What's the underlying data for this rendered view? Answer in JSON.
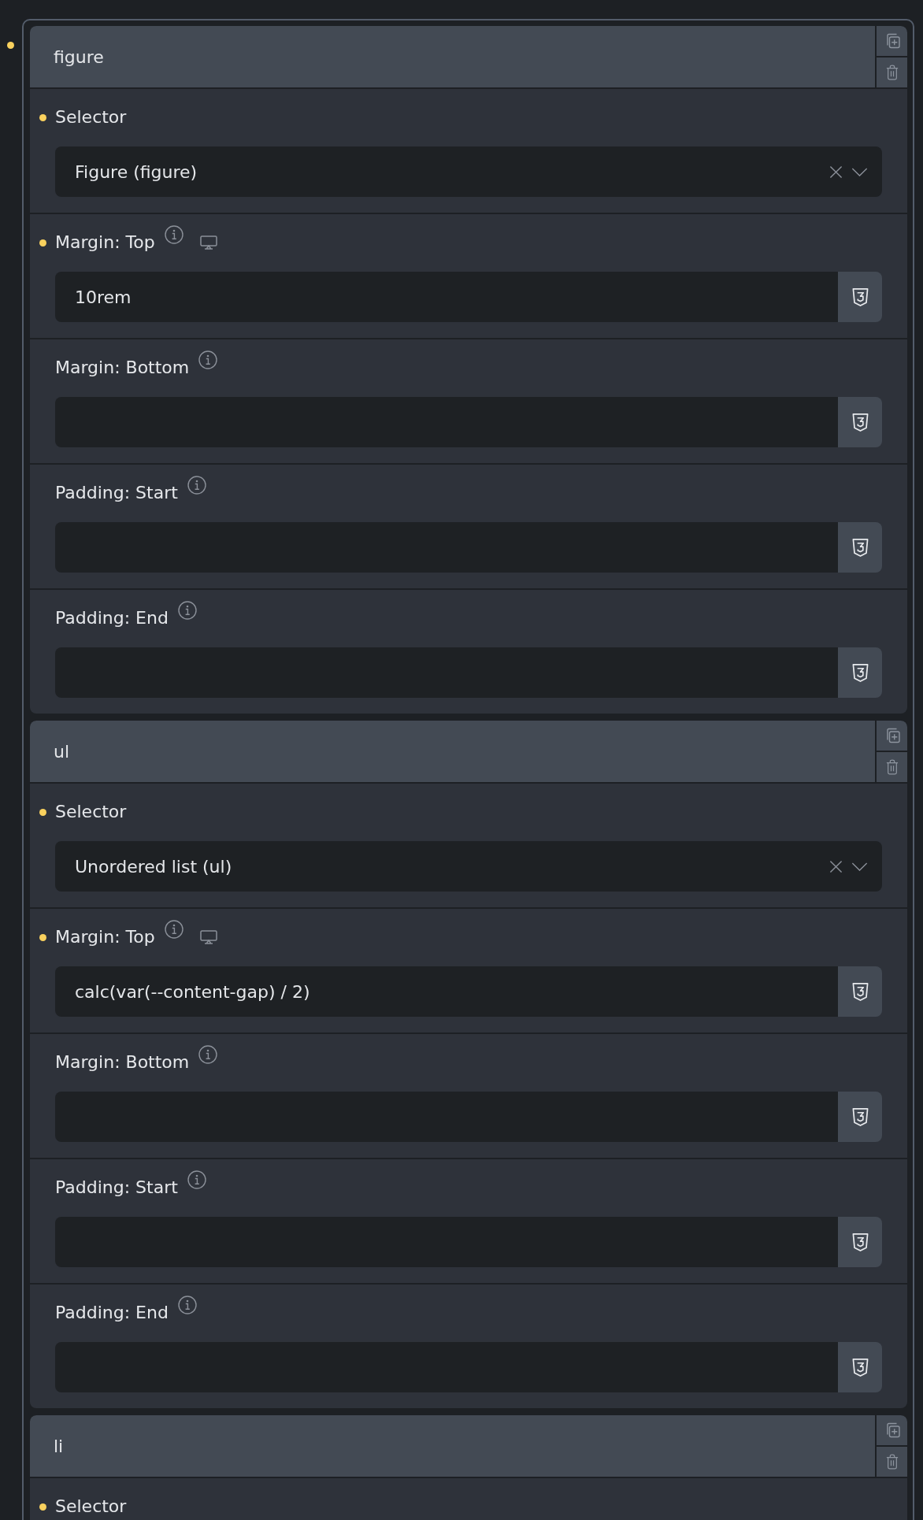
{
  "repeater": {
    "modified": true,
    "items": [
      {
        "title": "figure",
        "fields": [
          {
            "kind": "select",
            "label": "Selector",
            "modified": true,
            "info": false,
            "responsive": false,
            "value": "Figure (figure)"
          },
          {
            "kind": "text",
            "label": "Margin: Top",
            "modified": true,
            "info": true,
            "responsive": true,
            "value": "10rem"
          },
          {
            "kind": "text",
            "label": "Margin: Bottom",
            "modified": false,
            "info": true,
            "responsive": false
          },
          {
            "kind": "text",
            "label": "Padding: Start",
            "modified": false,
            "info": true,
            "responsive": false
          },
          {
            "kind": "text",
            "label": "Padding: End",
            "modified": false,
            "info": true,
            "responsive": false
          }
        ]
      },
      {
        "title": "ul",
        "fields": [
          {
            "kind": "select",
            "label": "Selector",
            "modified": true,
            "info": false,
            "responsive": false,
            "value": "Unordered list (ul)"
          },
          {
            "kind": "text",
            "label": "Margin: Top",
            "modified": true,
            "info": true,
            "responsive": true,
            "value": "calc(var(--content-gap) / 2)"
          },
          {
            "kind": "text",
            "label": "Margin: Bottom",
            "modified": false,
            "info": true,
            "responsive": false
          },
          {
            "kind": "text",
            "label": "Padding: Start",
            "modified": false,
            "info": true,
            "responsive": false
          },
          {
            "kind": "text",
            "label": "Padding: End",
            "modified": false,
            "info": true,
            "responsive": false
          }
        ]
      },
      {
        "title": "li",
        "fields": [
          {
            "kind": "select",
            "label": "Selector",
            "modified": true,
            "info": false,
            "responsive": false
          }
        ]
      }
    ]
  }
}
